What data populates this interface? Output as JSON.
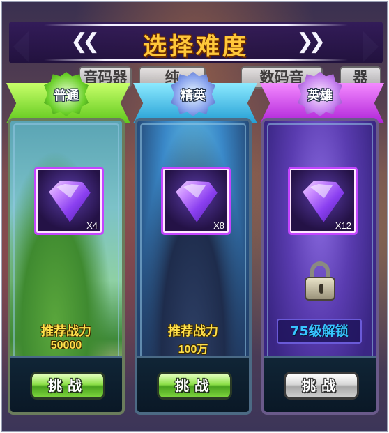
{
  "title": "选择难度",
  "background_tabs": [
    "音码器",
    "纯",
    "数码音",
    "器"
  ],
  "nav": {
    "prev_icon": "double-chevron-left",
    "next_icon": "double-chevron-right"
  },
  "cards": [
    {
      "difficulty": "普通",
      "accent": "#8ee83a",
      "reward_qty": "X4",
      "power_label": "推荐战力",
      "power_value": "50000",
      "button_label": "挑战",
      "locked": false
    },
    {
      "difficulty": "精英",
      "accent": "#3ec3ee",
      "reward_qty": "X8",
      "power_label": "推荐战力",
      "power_value": "100万",
      "button_label": "挑战",
      "locked": false
    },
    {
      "difficulty": "英雄",
      "accent": "#d04ef0",
      "reward_qty": "X12",
      "unlock_text": "75级解锁",
      "button_label": "挑战",
      "locked": true
    }
  ]
}
